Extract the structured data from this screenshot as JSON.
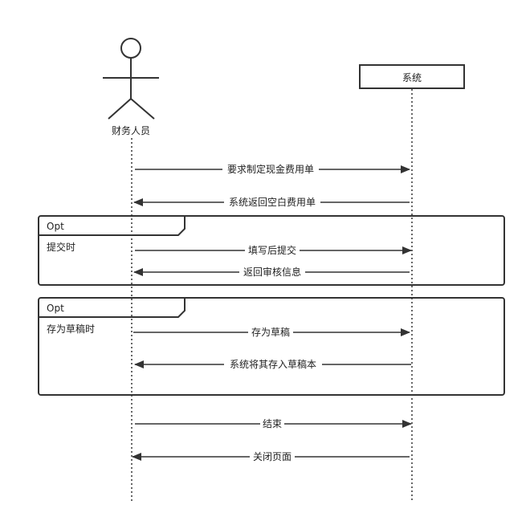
{
  "participants": {
    "actor": {
      "label": "财务人员",
      "icon": "stick-figure-icon"
    },
    "system": {
      "label": "系统"
    }
  },
  "messages": [
    {
      "label": "要求制定现金费用单",
      "direction": "actor-to-system"
    },
    {
      "label": "系统返回空白费用单",
      "direction": "system-to-actor"
    },
    {
      "label": "填写后提交",
      "direction": "actor-to-system"
    },
    {
      "label": "返回审核信息",
      "direction": "system-to-actor"
    },
    {
      "label": "存为草稿",
      "direction": "actor-to-system"
    },
    {
      "label": "系统将其存入草稿本",
      "direction": "system-to-actor"
    },
    {
      "label": "结束",
      "direction": "actor-to-system"
    },
    {
      "label": "关闭页面",
      "direction": "system-to-actor"
    }
  ],
  "fragments": [
    {
      "operator": "Opt",
      "guard": "提交时"
    },
    {
      "operator": "Opt",
      "guard": "存为草稿时"
    }
  ],
  "colors": {
    "line": "#333333",
    "background": "#ffffff"
  }
}
